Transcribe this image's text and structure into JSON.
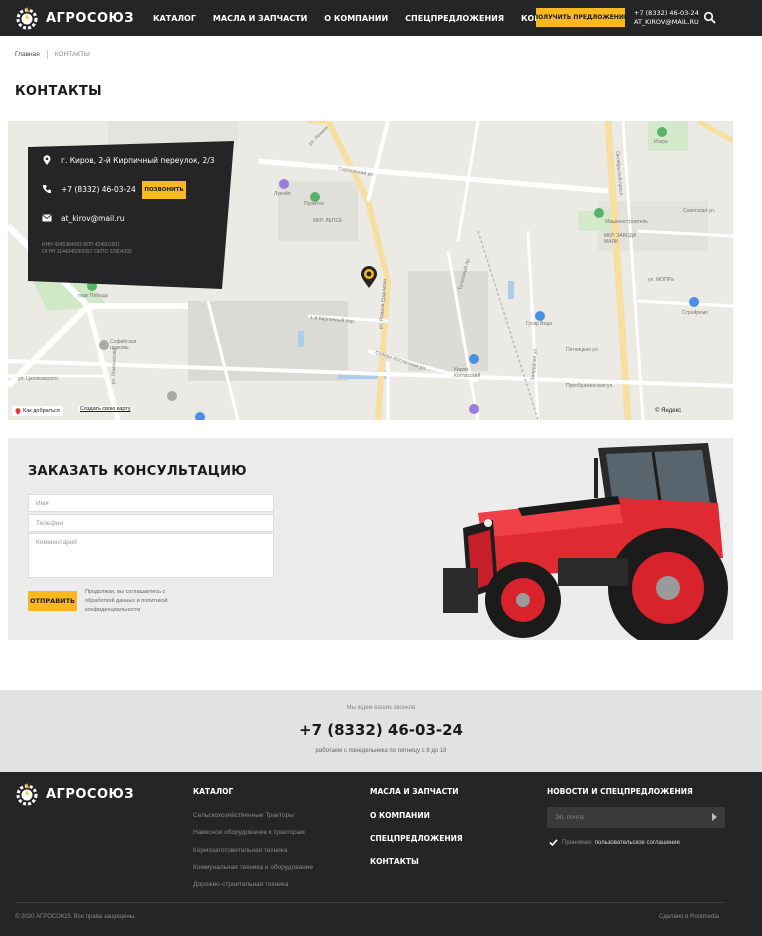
{
  "header": {
    "logo_text": "АГРОСОЮЗ",
    "nav": [
      "КАТАЛОГ",
      "МАСЛА И ЗАПЧАСТИ",
      "О КОМПАНИИ",
      "СПЕЦПРЕДЛОЖЕНИЯ",
      "КОНТАКТЫ"
    ],
    "cta_label": "ПОЛУЧИТЬ ПРЕДЛОЖЕНИЕ",
    "phone": "+7 (8332) 46-03-24",
    "email": "AT_KIROV@MAIL.RU",
    "search_icon": "search-icon"
  },
  "breadcrumb": {
    "home": "Главная",
    "current": "КОНТАКТЫ"
  },
  "page_title": "КОНТАКТЫ",
  "map": {
    "labels": {
      "street_lenina": "ул. Ленина",
      "sormovskaya": "Сормовская ул.",
      "oktyabrsky": "Октябрьский просп.",
      "lukoil": "Лукойл",
      "promtek": "Промтек",
      "mkr_lepse": "МКР. ЛЕПСЕ",
      "iskra": "Искра",
      "sovetskaya": "Советская ул.",
      "mashinostroitel": "Машиностроитель",
      "mkr_zavoda": "МКР. ЗАВОДА МАЯК",
      "park_pobedy": "парк Победы",
      "sofiyskaya": "Софийская церковь",
      "lomonosova": "ул. Ломоносова",
      "romana_erdomova": "ул. Романа Ердомова",
      "pervy_kirpichny": "1-й Кирпичный пер.",
      "severo_kotlasskaya": "Северо-Котласская ул.",
      "tupikovy": "Тупиковый пр.",
      "kirov_kotlassky": "Киров-Котласский",
      "gusar_voda": "Гусар Вода",
      "stroiremo": "Стройремо",
      "mopra": "ул. МОПРа",
      "preobrazhenskaya": "Преображенская ул.",
      "pyatnitskaya": "Пятницкая ул.",
      "zaprudnaya": "Запрудная ул.",
      "tsiolkovskogo": "ул. Циолковского"
    },
    "contact_address": "г. Киров, 2-й Кирпичный переулок, 2/3",
    "contact_phone": "+7 (8332) 46-03-24",
    "call_label": "ПОЗВОНИТЬ",
    "contact_email": "at_kirov@mail.ru",
    "requisites_line1": "ИНН 4345384002 КПП 434501001",
    "requisites_line2": "ОГРН 1144345000357 ОКПО 32804305",
    "route_label": "Как добраться",
    "create_map_label": "Создать свою карту",
    "yandex_label": "© Яндекс"
  },
  "consult": {
    "title": "ЗАКАЗАТЬ КОНСУЛЬТАЦИЮ",
    "name_placeholder": "Имя",
    "phone_placeholder": "Телефон",
    "comment_placeholder": "Комментарий",
    "submit_label": "ОТПРАВИТЬ",
    "consent_text": "Продолжая, вы соглашаетесь с обработкой данных и политикой конфиденциальности"
  },
  "callstrip": {
    "top": "Мы ждем ваших звонков",
    "phone": "+7 (8332) 46-03-24",
    "hours": "работаем с понедельника по пятницу с 8 до 18"
  },
  "footer": {
    "logo_text": "АГРОСОЮЗ",
    "catalog_head": "КАТАЛОГ",
    "catalog_links": [
      "Сельскохозяйственные Тракторы",
      "Навесное оборудование к тракторам",
      "Кормозаготовительная техника",
      "Коммунальная техника и оборудование",
      "Дорожно-строительная техника"
    ],
    "col2": [
      "МАСЛА И ЗАПЧАСТИ",
      "О КОМПАНИИ",
      "СПЕЦПРЕДЛОЖЕНИЯ",
      "КОНТАКТЫ"
    ],
    "news_head": "НОВОСТИ И СПЕЦПРЕДЛОЖЕНИЯ",
    "email_placeholder": "Эл. почта",
    "agree_text": "Принимаю",
    "agree_link": "пользовательское соглашение",
    "copyright": "© 2020 АГРОСОЮЗ. Все права защищены.",
    "made_by": "Сделано в Rootmedia"
  },
  "colors": {
    "dark": "#252527",
    "accent": "#f8b820",
    "tractor_red": "#e02a32"
  }
}
